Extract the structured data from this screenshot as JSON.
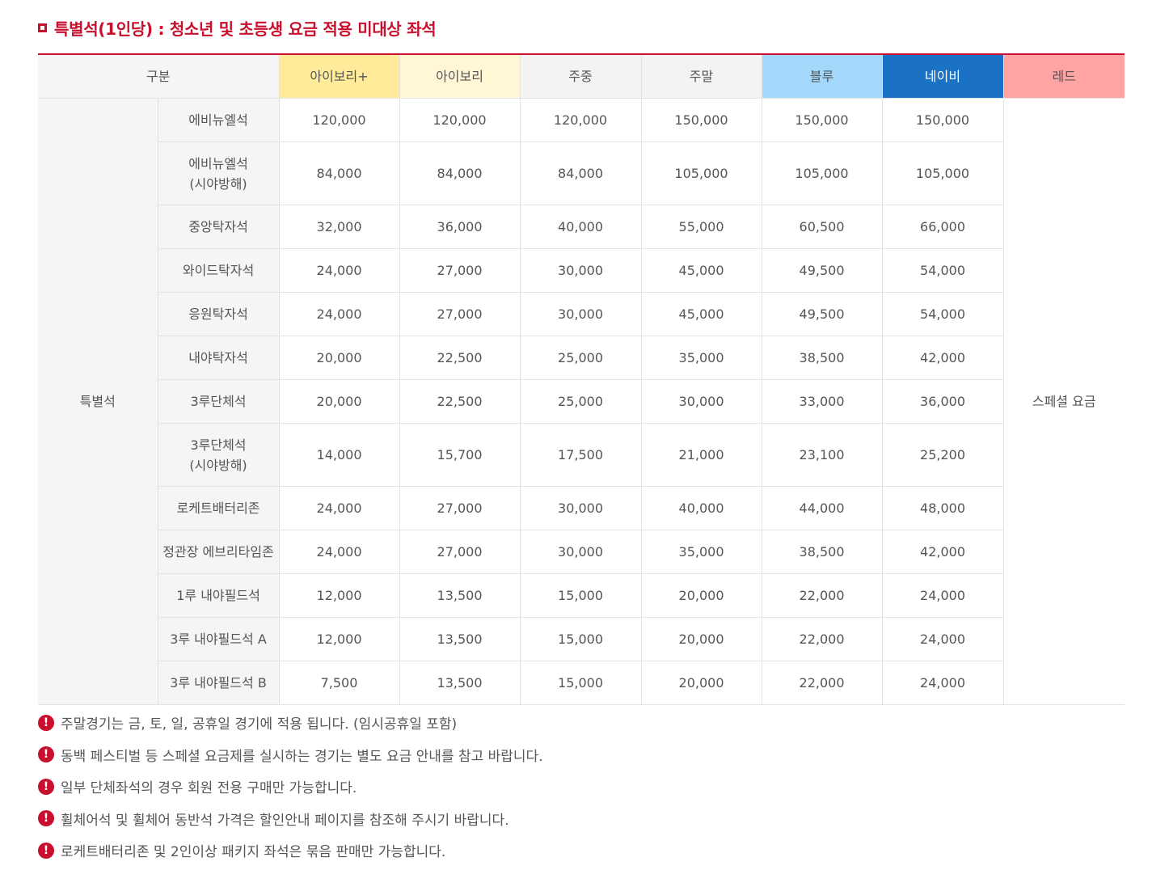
{
  "section": {
    "title": "특별석(1인당) : 청소년 및 초등생 요금 적용 미대상 좌석",
    "bullet_icon": "square-bullet-icon"
  },
  "colors": {
    "accent_red": "#c8102e",
    "ivory_plus": "#ffeb99",
    "ivory": "#fff7d6",
    "weekday": "#f3f3f3",
    "weekend": "#f3f3f3",
    "blue": "#a3d8fb",
    "navy": "#1b72c4",
    "red": "#fea4a5"
  },
  "table": {
    "header": {
      "category": "구분",
      "grades": [
        {
          "label": "아이보리+",
          "bg": "#ffeb99",
          "fg": "#555555"
        },
        {
          "label": "아이보리",
          "bg": "#fff7d6",
          "fg": "#555555"
        },
        {
          "label": "주중",
          "bg": "#f3f3f3",
          "fg": "#555555"
        },
        {
          "label": "주말",
          "bg": "#f3f3f3",
          "fg": "#555555"
        },
        {
          "label": "블루",
          "bg": "#a3d8fb",
          "fg": "#555555"
        },
        {
          "label": "네이비",
          "bg": "#1b72c4",
          "fg": "#ffffff"
        },
        {
          "label": "레드",
          "bg": "#fea4a5",
          "fg": "#555555"
        }
      ]
    },
    "group_label": "특별석",
    "red_note": "스페셜 요금",
    "rows": [
      {
        "seat": "에비뉴엘석",
        "prices": [
          "120,000",
          "120,000",
          "120,000",
          "150,000",
          "150,000",
          "150,000"
        ]
      },
      {
        "seat": "에비뉴엘석\n(시야방해)",
        "prices": [
          "84,000",
          "84,000",
          "84,000",
          "105,000",
          "105,000",
          "105,000"
        ]
      },
      {
        "seat": "중앙탁자석",
        "prices": [
          "32,000",
          "36,000",
          "40,000",
          "55,000",
          "60,500",
          "66,000"
        ]
      },
      {
        "seat": "와이드탁자석",
        "prices": [
          "24,000",
          "27,000",
          "30,000",
          "45,000",
          "49,500",
          "54,000"
        ]
      },
      {
        "seat": "응원탁자석",
        "prices": [
          "24,000",
          "27,000",
          "30,000",
          "45,000",
          "49,500",
          "54,000"
        ]
      },
      {
        "seat": "내야탁자석",
        "prices": [
          "20,000",
          "22,500",
          "25,000",
          "35,000",
          "38,500",
          "42,000"
        ]
      },
      {
        "seat": "3루단체석",
        "prices": [
          "20,000",
          "22,500",
          "25,000",
          "30,000",
          "33,000",
          "36,000"
        ]
      },
      {
        "seat": "3루단체석\n(시야방해)",
        "prices": [
          "14,000",
          "15,700",
          "17,500",
          "21,000",
          "23,100",
          "25,200"
        ]
      },
      {
        "seat": "로케트배터리존",
        "prices": [
          "24,000",
          "27,000",
          "30,000",
          "40,000",
          "44,000",
          "48,000"
        ]
      },
      {
        "seat": "정관장 에브리타임존",
        "prices": [
          "24,000",
          "27,000",
          "30,000",
          "35,000",
          "38,500",
          "42,000"
        ]
      },
      {
        "seat": "1루 내야필드석",
        "prices": [
          "12,000",
          "13,500",
          "15,000",
          "20,000",
          "22,000",
          "24,000"
        ]
      },
      {
        "seat": "3루 내야필드석 A",
        "prices": [
          "12,000",
          "13,500",
          "15,000",
          "20,000",
          "22,000",
          "24,000"
        ]
      },
      {
        "seat": "3루 내야필드석 B",
        "prices": [
          "7,500",
          "13,500",
          "15,000",
          "20,000",
          "22,000",
          "24,000"
        ]
      }
    ]
  },
  "notes": {
    "icon": "exclamation-circle-icon",
    "icon_glyph": "!",
    "items": [
      "주말경기는 금, 토, 일, 공휴일 경기에 적용 됩니다. (임시공휴일 포함)",
      "동백 페스티벌 등 스페셜 요금제를 실시하는 경기는 별도 요금 안내를 참고 바랍니다.",
      "일부 단체좌석의 경우 회원 전용 구매만 가능합니다.",
      "휠체어석 및 휠체어 동반석 가격은 할인안내 페이지를 참조해 주시기 바랍니다.",
      "로케트배터리존 및 2인이상 패키지 좌석은 묶음 판매만 가능합니다."
    ]
  }
}
